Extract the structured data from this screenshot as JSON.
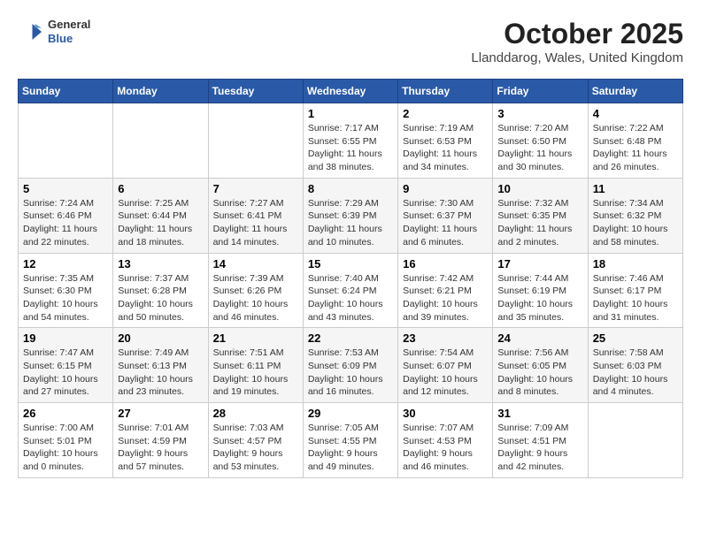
{
  "header": {
    "logo": {
      "general": "General",
      "blue": "Blue"
    },
    "title": "October 2025",
    "location": "Llanddarog, Wales, United Kingdom"
  },
  "weekdays": [
    "Sunday",
    "Monday",
    "Tuesday",
    "Wednesday",
    "Thursday",
    "Friday",
    "Saturday"
  ],
  "weeks": [
    [
      {
        "day": "",
        "info": ""
      },
      {
        "day": "",
        "info": ""
      },
      {
        "day": "",
        "info": ""
      },
      {
        "day": "1",
        "info": "Sunrise: 7:17 AM\nSunset: 6:55 PM\nDaylight: 11 hours\nand 38 minutes."
      },
      {
        "day": "2",
        "info": "Sunrise: 7:19 AM\nSunset: 6:53 PM\nDaylight: 11 hours\nand 34 minutes."
      },
      {
        "day": "3",
        "info": "Sunrise: 7:20 AM\nSunset: 6:50 PM\nDaylight: 11 hours\nand 30 minutes."
      },
      {
        "day": "4",
        "info": "Sunrise: 7:22 AM\nSunset: 6:48 PM\nDaylight: 11 hours\nand 26 minutes."
      }
    ],
    [
      {
        "day": "5",
        "info": "Sunrise: 7:24 AM\nSunset: 6:46 PM\nDaylight: 11 hours\nand 22 minutes."
      },
      {
        "day": "6",
        "info": "Sunrise: 7:25 AM\nSunset: 6:44 PM\nDaylight: 11 hours\nand 18 minutes."
      },
      {
        "day": "7",
        "info": "Sunrise: 7:27 AM\nSunset: 6:41 PM\nDaylight: 11 hours\nand 14 minutes."
      },
      {
        "day": "8",
        "info": "Sunrise: 7:29 AM\nSunset: 6:39 PM\nDaylight: 11 hours\nand 10 minutes."
      },
      {
        "day": "9",
        "info": "Sunrise: 7:30 AM\nSunset: 6:37 PM\nDaylight: 11 hours\nand 6 minutes."
      },
      {
        "day": "10",
        "info": "Sunrise: 7:32 AM\nSunset: 6:35 PM\nDaylight: 11 hours\nand 2 minutes."
      },
      {
        "day": "11",
        "info": "Sunrise: 7:34 AM\nSunset: 6:32 PM\nDaylight: 10 hours\nand 58 minutes."
      }
    ],
    [
      {
        "day": "12",
        "info": "Sunrise: 7:35 AM\nSunset: 6:30 PM\nDaylight: 10 hours\nand 54 minutes."
      },
      {
        "day": "13",
        "info": "Sunrise: 7:37 AM\nSunset: 6:28 PM\nDaylight: 10 hours\nand 50 minutes."
      },
      {
        "day": "14",
        "info": "Sunrise: 7:39 AM\nSunset: 6:26 PM\nDaylight: 10 hours\nand 46 minutes."
      },
      {
        "day": "15",
        "info": "Sunrise: 7:40 AM\nSunset: 6:24 PM\nDaylight: 10 hours\nand 43 minutes."
      },
      {
        "day": "16",
        "info": "Sunrise: 7:42 AM\nSunset: 6:21 PM\nDaylight: 10 hours\nand 39 minutes."
      },
      {
        "day": "17",
        "info": "Sunrise: 7:44 AM\nSunset: 6:19 PM\nDaylight: 10 hours\nand 35 minutes."
      },
      {
        "day": "18",
        "info": "Sunrise: 7:46 AM\nSunset: 6:17 PM\nDaylight: 10 hours\nand 31 minutes."
      }
    ],
    [
      {
        "day": "19",
        "info": "Sunrise: 7:47 AM\nSunset: 6:15 PM\nDaylight: 10 hours\nand 27 minutes."
      },
      {
        "day": "20",
        "info": "Sunrise: 7:49 AM\nSunset: 6:13 PM\nDaylight: 10 hours\nand 23 minutes."
      },
      {
        "day": "21",
        "info": "Sunrise: 7:51 AM\nSunset: 6:11 PM\nDaylight: 10 hours\nand 19 minutes."
      },
      {
        "day": "22",
        "info": "Sunrise: 7:53 AM\nSunset: 6:09 PM\nDaylight: 10 hours\nand 16 minutes."
      },
      {
        "day": "23",
        "info": "Sunrise: 7:54 AM\nSunset: 6:07 PM\nDaylight: 10 hours\nand 12 minutes."
      },
      {
        "day": "24",
        "info": "Sunrise: 7:56 AM\nSunset: 6:05 PM\nDaylight: 10 hours\nand 8 minutes."
      },
      {
        "day": "25",
        "info": "Sunrise: 7:58 AM\nSunset: 6:03 PM\nDaylight: 10 hours\nand 4 minutes."
      }
    ],
    [
      {
        "day": "26",
        "info": "Sunrise: 7:00 AM\nSunset: 5:01 PM\nDaylight: 10 hours\nand 0 minutes."
      },
      {
        "day": "27",
        "info": "Sunrise: 7:01 AM\nSunset: 4:59 PM\nDaylight: 9 hours\nand 57 minutes."
      },
      {
        "day": "28",
        "info": "Sunrise: 7:03 AM\nSunset: 4:57 PM\nDaylight: 9 hours\nand 53 minutes."
      },
      {
        "day": "29",
        "info": "Sunrise: 7:05 AM\nSunset: 4:55 PM\nDaylight: 9 hours\nand 49 minutes."
      },
      {
        "day": "30",
        "info": "Sunrise: 7:07 AM\nSunset: 4:53 PM\nDaylight: 9 hours\nand 46 minutes."
      },
      {
        "day": "31",
        "info": "Sunrise: 7:09 AM\nSunset: 4:51 PM\nDaylight: 9 hours\nand 42 minutes."
      },
      {
        "day": "",
        "info": ""
      }
    ]
  ]
}
